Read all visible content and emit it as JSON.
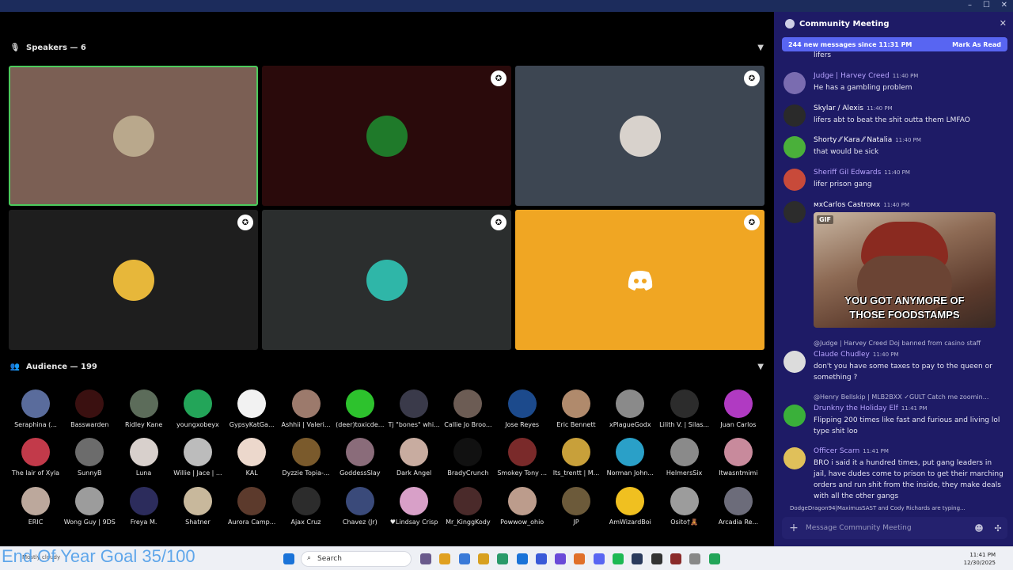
{
  "window": {
    "controls": [
      "–",
      "☐",
      "✕"
    ]
  },
  "speakers": {
    "header": "Speakers — 6",
    "icon": "microphone-icon"
  },
  "speaker_tiles": [
    {
      "bg": "#7b5f54",
      "avatar": "#b9a88c",
      "highlight": true,
      "badge": false
    },
    {
      "bg": "#2a0a0b",
      "avatar": "#1f7a2a",
      "highlight": false,
      "badge": true
    },
    {
      "bg": "#3d4652",
      "avatar": "#d8d2cc",
      "highlight": false,
      "badge": true
    },
    {
      "bg": "#1e1e1e",
      "avatar": "#e7b73a",
      "highlight": false,
      "badge": true
    },
    {
      "bg": "#2b2e2e",
      "avatar": "#2fb6a8",
      "highlight": false,
      "badge": true
    },
    {
      "bg": "#f0a623",
      "avatar": null,
      "highlight": false,
      "badge": true,
      "logo": "discord-logo-icon"
    }
  ],
  "audience": {
    "header": "Audience — 199",
    "icon": "audience-icon",
    "rows": [
      [
        {
          "name": "Seraphina (...",
          "color": "#5a6c9c"
        },
        {
          "name": "Basswarden",
          "color": "#3a1010"
        },
        {
          "name": "Ridley Kane",
          "color": "#5c6c5a"
        },
        {
          "name": "youngxobeyx",
          "color": "#23a559"
        },
        {
          "name": "GypsyKatGa...",
          "color": "#f2f2f2"
        },
        {
          "name": "Ashhii | Valeri...",
          "color": "#9c7a6c"
        },
        {
          "name": "(deer)toxicde...",
          "color": "#2dc22d"
        },
        {
          "name": "Tj \"bones\" whi...",
          "color": "#3a3a4a"
        },
        {
          "name": "Callie Jo Broo...",
          "color": "#6c5c54"
        },
        {
          "name": "Jose Reyes",
          "color": "#1c4a8c"
        },
        {
          "name": "Eric Bennett",
          "color": "#b08a6c"
        },
        {
          "name": "xPlagueGodx",
          "color": "#8a8a8a"
        },
        {
          "name": "Lilith V. | Silas...",
          "color": "#2c2c2c"
        },
        {
          "name": "Juan Carlos",
          "color": "#b03ac2"
        }
      ],
      [
        {
          "name": "The lair of Xyla",
          "color": "#c23a4a"
        },
        {
          "name": "SunnyB",
          "color": "#6c6c6c"
        },
        {
          "name": "Luna",
          "color": "#d8d0cc"
        },
        {
          "name": "Willie | Jace | ...",
          "color": "#bcbcbc"
        },
        {
          "name": "KAL",
          "color": "#ecd8cc"
        },
        {
          "name": "Dyzzie Topia-...",
          "color": "#7a5a2c"
        },
        {
          "name": "GoddessSlay",
          "color": "#8a6c7a"
        },
        {
          "name": "Dark Angel",
          "color": "#c8aca0"
        },
        {
          "name": "BradyCrunch",
          "color": "#111111"
        },
        {
          "name": "Smokey Tony ...",
          "color": "#7a2a2a"
        },
        {
          "name": "Its_trentt | M...",
          "color": "#c8a03a"
        },
        {
          "name": "Norman John...",
          "color": "#2aa0c8"
        },
        {
          "name": "HelmersSix",
          "color": "#8a8a8a"
        },
        {
          "name": "Itwasntmimi",
          "color": "#c88a9c"
        }
      ],
      [
        {
          "name": "ERIC",
          "color": "#bca89c"
        },
        {
          "name": "Wong Guy | 9DS",
          "color": "#9c9c9c"
        },
        {
          "name": "Freya M.",
          "color": "#2c2c5c"
        },
        {
          "name": "Shatner",
          "color": "#c8b89c"
        },
        {
          "name": "Aurora Camp...",
          "color": "#5c3a2c"
        },
        {
          "name": "Ajax Cruz",
          "color": "#2c2c2c"
        },
        {
          "name": "Chavez (Jr)",
          "color": "#3a4a7a"
        },
        {
          "name": "♥Lindsay Crisp",
          "color": "#d8a0c8"
        },
        {
          "name": "Mr_KinggKody",
          "color": "#4a2a2a"
        },
        {
          "name": "Powwow_ohio",
          "color": "#bc9c8c"
        },
        {
          "name": "JP",
          "color": "#6c5a3a"
        },
        {
          "name": "AmWizardBoi",
          "color": "#f0c020"
        },
        {
          "name": "Osito†🧸",
          "color": "#9c9c9c"
        },
        {
          "name": "Arcadia Re...",
          "color": "#6c6c7a"
        }
      ]
    ]
  },
  "overlay": {
    "goal_text": "End Of Year Goal 35/100"
  },
  "chat": {
    "title": "Community Meeting",
    "new_messages": "244 new messages since 11:31 PM",
    "mark_read": "Mark As Read",
    "top_fragment": "lifers",
    "messages": [
      {
        "author": "Judge | Harvey Creed",
        "author_color": "#b7a3ff",
        "time": "11:40 PM",
        "text": "He has a gambling problem",
        "avatar": "#7a6cb0"
      },
      {
        "author": "Skylar / Alexis",
        "author_color": "#ffffff",
        "time": "11:40 PM",
        "text": "lifers abt to beat the shit outta them LMFAO",
        "avatar": "#2a2a2a"
      },
      {
        "author": "Shorty ⁄⁄ Kara ⁄⁄ Natalia",
        "author_color": "#ffffff",
        "time": "11:40 PM",
        "text": "that would be sick",
        "avatar": "#4ab03a"
      },
      {
        "author": "Sheriff Gil Edwards",
        "author_color": "#b7a3ff",
        "time": "11:40 PM",
        "text": "lifer prison gang",
        "avatar": "#c84a3a"
      },
      {
        "author": "мxCarlos Castroмx",
        "author_color": "#ffffff",
        "time": "11:40 PM",
        "text": "",
        "avatar": "#2c2c2c"
      },
      {
        "author": "Claude Chudley",
        "author_color": "#b7a3ff",
        "time": "11:40 PM",
        "text": "don't you have some taxes to pay to the queen or something ?",
        "avatar": "#dcdcdc"
      },
      {
        "author": "Drunkny the Holiday Elf",
        "author_color": "#b7a3ff",
        "time": "11:41 PM",
        "text": "Flipping 200 times like fast and furious and living lol type shit loo",
        "avatar": "#3ab03a"
      },
      {
        "author": "Officer Scarn",
        "author_color": "#b7a3ff",
        "time": "11:41 PM",
        "text": "BRO i said it a hundred times, put gang leaders in jail, have dudes come to prison to get their marching orders and run shit from the inside, they make deals with all the other gangs",
        "avatar": "#e0c05a"
      }
    ],
    "replies": [
      {
        "text": "@Judge | Harvey Creed  Doj banned from casino staff"
      },
      {
        "text": "@Henry Bellskip | MLB2BXX  ✓GULT  Catch me zoomin..."
      }
    ],
    "gif": {
      "label": "GIF",
      "caption_line1": "YOU GOT ANYMORE OF",
      "caption_line2": "THOSE FOODSTAMPS"
    },
    "typing": "DodgeDragon94|MaximusSAST and Cody Richards are typing...",
    "composer_placeholder": "Message Community Meeting"
  },
  "taskbar": {
    "search": "Search",
    "weather": "Mostly cloudy",
    "time": "11:41 PM",
    "date": "12/30/2025"
  }
}
